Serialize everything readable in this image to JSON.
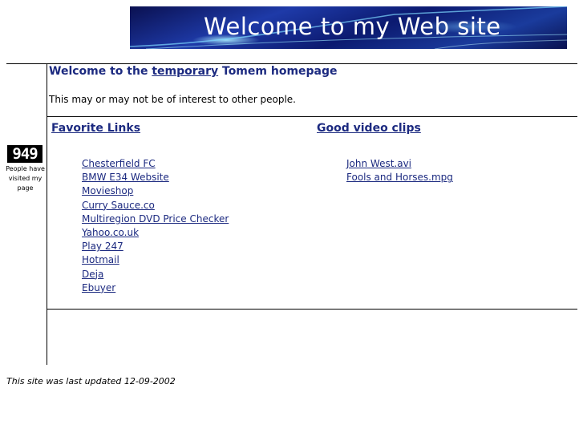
{
  "banner": {
    "text": "Welcome to my Web site"
  },
  "counter": {
    "value": "949",
    "caption": "People have visited my page"
  },
  "heading": {
    "prefix": "Welcome to the ",
    "link": "temporary",
    "suffix": " Tomem homepage"
  },
  "intro": "This may or may not be of interest to other people.",
  "favorites": {
    "title": "Favorite Links",
    "items": [
      "Chesterfield FC",
      "BMW E34 Website",
      "Movieshop",
      "Curry Sauce.co",
      "Multiregion DVD Price Checker",
      "Yahoo.co.uk",
      "Play 247",
      "Hotmail",
      "Deja",
      "Ebuyer"
    ]
  },
  "videos": {
    "title": "Good video clips",
    "items": [
      "John West.avi",
      "Fools and Horses.mpg"
    ]
  },
  "footer": "This site was last updated 12-09-2002",
  "colors": {
    "link": "#1c2a80",
    "banner_dark": "#0a1050",
    "banner_light": "#1e3aa8"
  }
}
